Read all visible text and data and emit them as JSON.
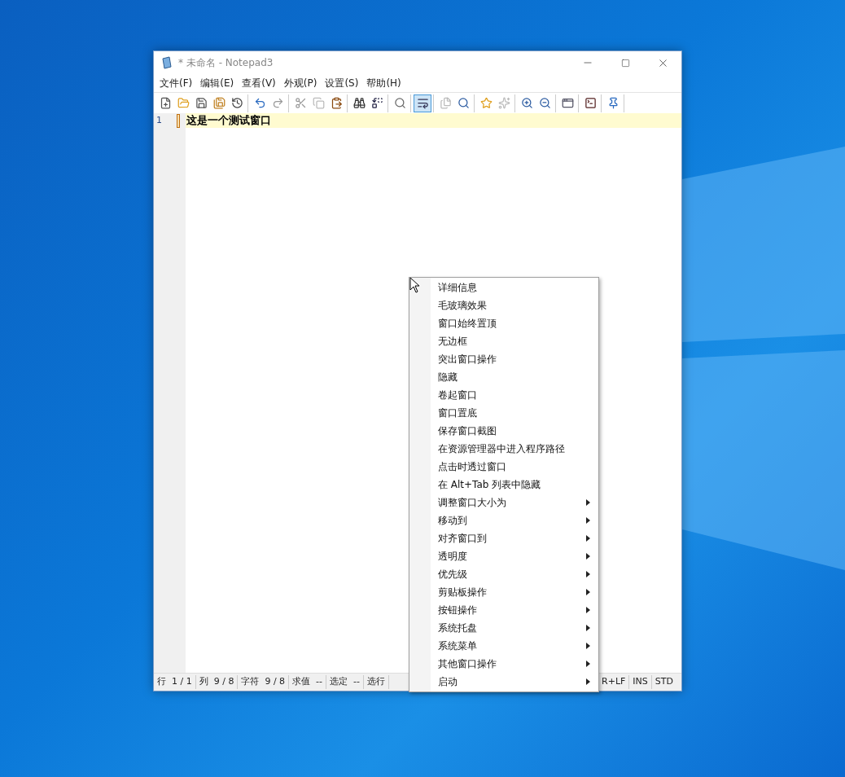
{
  "window": {
    "title": "* 未命名 - Notepad3"
  },
  "menu_bar": [
    "文件(F)",
    "编辑(E)",
    "查看(V)",
    "外观(P)",
    "设置(S)",
    "帮助(H)"
  ],
  "toolbar_groups": [
    [
      {
        "on": false
      },
      {
        "on": false
      },
      {
        "on": false
      },
      {
        "on": false
      },
      {
        "on": false
      }
    ],
    [
      {
        "on": false
      },
      {
        "on": false
      }
    ],
    [
      {
        "on": false
      },
      {
        "on": false
      },
      {
        "on": false
      }
    ],
    [
      {
        "on": false
      },
      {
        "on": false
      }
    ],
    [
      {
        "on": false
      }
    ],
    [
      {
        "on": true
      }
    ],
    [
      {
        "on": false
      },
      {
        "on": false
      }
    ],
    [
      {
        "on": false
      },
      {
        "on": false
      }
    ],
    [
      {
        "on": false
      },
      {
        "on": false
      }
    ],
    [
      {
        "on": false
      }
    ],
    [
      {
        "on": false
      }
    ],
    [
      {
        "on": false
      }
    ]
  ],
  "editor": {
    "lines": [
      {
        "number": "1",
        "text": "这是一个测试窗口",
        "current": true
      }
    ]
  },
  "status_bar": [
    "行  1 / 1",
    "列  9 / 8",
    "字符  9 / 8",
    "求值  --",
    "选定  --",
    "选行"
  ],
  "status_bar_right": [
    "R+LF",
    "INS",
    "STD"
  ],
  "context_menu": [
    {
      "label": "详细信息",
      "submenu": false
    },
    {
      "label": "毛玻璃效果",
      "submenu": false
    },
    {
      "label": "窗口始终置顶",
      "submenu": false
    },
    {
      "label": "无边框",
      "submenu": false
    },
    {
      "label": "突出窗口操作",
      "submenu": false
    },
    {
      "label": "隐藏",
      "submenu": false
    },
    {
      "label": "卷起窗口",
      "submenu": false
    },
    {
      "label": "窗口置底",
      "submenu": false
    },
    {
      "label": "保存窗口截图",
      "submenu": false
    },
    {
      "label": "在资源管理器中进入程序路径",
      "submenu": false
    },
    {
      "label": "点击时透过窗口",
      "submenu": false
    },
    {
      "label": "在 Alt+Tab 列表中隐藏",
      "submenu": false
    },
    {
      "label": "调整窗口大小为",
      "submenu": true
    },
    {
      "label": "移动到",
      "submenu": true
    },
    {
      "label": "对齐窗口到",
      "submenu": true
    },
    {
      "label": "透明度",
      "submenu": true
    },
    {
      "label": "优先级",
      "submenu": true
    },
    {
      "label": "剪贴板操作",
      "submenu": true
    },
    {
      "label": "按钮操作",
      "submenu": true
    },
    {
      "label": "系统托盘",
      "submenu": true
    },
    {
      "label": "系统菜单",
      "submenu": true
    },
    {
      "label": "其他窗口操作",
      "submenu": true
    },
    {
      "label": "启动",
      "submenu": true
    }
  ]
}
